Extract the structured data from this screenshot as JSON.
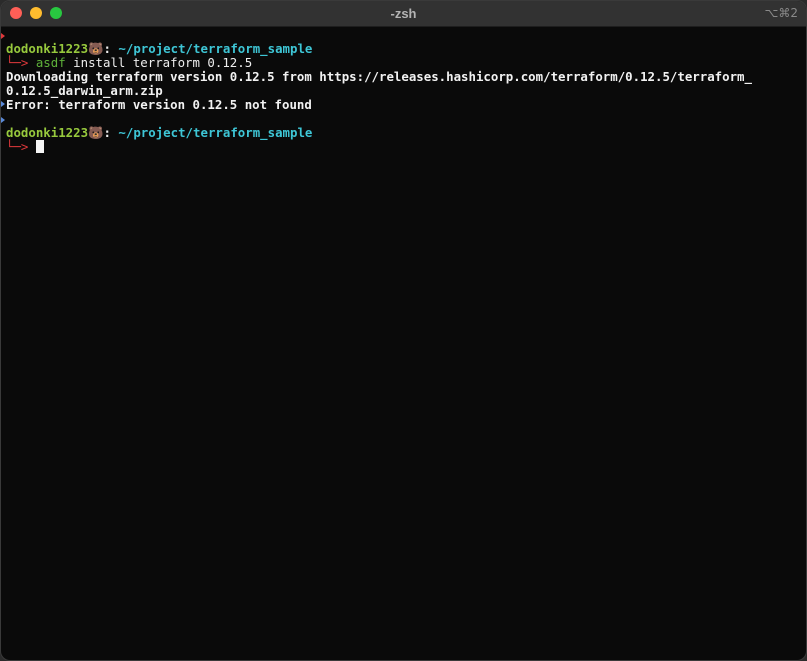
{
  "window": {
    "title": "-zsh",
    "shortcut": "⌥⌘2"
  },
  "terminal": {
    "lines": [
      {
        "user": "dodonki1223",
        "emoji": "🐻",
        "sep": ": ",
        "path": "~/project/terraform_sample"
      },
      {
        "arrow": "└─> ",
        "cmd": "asdf",
        "rest": " install terraform 0.12.5"
      },
      {
        "text": "Downloading terraform version 0.12.5 from https://releases.hashicorp.com/terraform/0.12.5/terraform_"
      },
      {
        "text": "0.12.5_darwin_arm.zip"
      },
      {
        "text": "Error: terraform version 0.12.5 not found"
      },
      {
        "text": ""
      },
      {
        "user": "dodonki1223",
        "emoji": "🐻",
        "sep": ": ",
        "path": "~/project/terraform_sample"
      },
      {
        "arrow": "└─> "
      }
    ]
  },
  "colors": {
    "user": "#97c93d",
    "path": "#3ec6d6",
    "arrow": "#e0393c",
    "command": "#5fb23a",
    "background": "#0a0a0a"
  }
}
